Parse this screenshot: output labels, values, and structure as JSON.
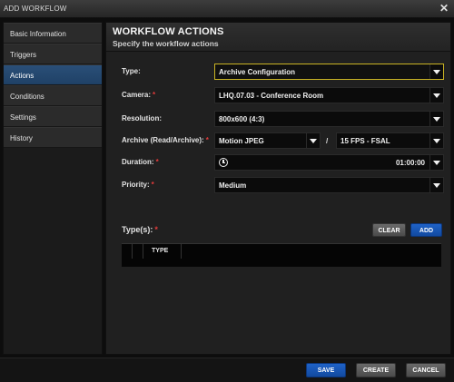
{
  "window": {
    "title": "ADD WORKFLOW"
  },
  "sidebar": {
    "items": [
      {
        "label": "Basic Information"
      },
      {
        "label": "Triggers"
      },
      {
        "label": "Actions"
      },
      {
        "label": "Conditions"
      },
      {
        "label": "Settings"
      },
      {
        "label": "History"
      }
    ],
    "active_index": 2
  },
  "panel": {
    "title": "WORKFLOW ACTIONS",
    "subtitle": "Specify the workflow actions"
  },
  "form": {
    "type": {
      "label": "Type:",
      "value": "Archive Configuration"
    },
    "camera": {
      "label": "Camera:",
      "required": "*",
      "value": "LHQ.07.03 - Conference Room"
    },
    "resolution": {
      "label": "Resolution:",
      "value": "800x600  (4:3)"
    },
    "archive": {
      "label": "Archive (Read/Archive):",
      "required": "*",
      "codec": "Motion JPEG",
      "separator": "/",
      "fps": "15 FPS - FSAL"
    },
    "duration": {
      "label": "Duration:",
      "required": "*",
      "value": "01:00:00"
    },
    "priority": {
      "label": "Priority:",
      "required": "*",
      "value": "Medium"
    },
    "types": {
      "label": "Type(s):",
      "required": "*",
      "clear_label": "CLEAR",
      "add_label": "ADD",
      "column_header": "TYPE"
    }
  },
  "footer": {
    "save_label": "SAVE",
    "create_label": "CREATE",
    "cancel_label": "CANCEL"
  },
  "colors": {
    "accent_blue": "#1f62c7",
    "active_tab": "#2a4f78",
    "highlight_border": "#c9b324",
    "required": "#e23b3b"
  }
}
